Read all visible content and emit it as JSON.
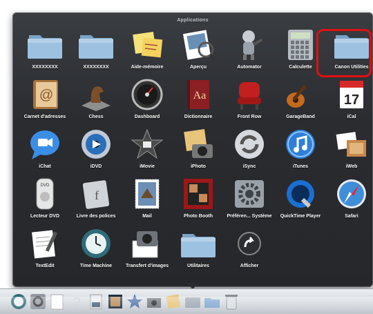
{
  "stack": {
    "title": "Applications",
    "apps": [
      {
        "label": "XXXXXXXX",
        "icon": "folder-icon"
      },
      {
        "label": "XXXXXXXX",
        "icon": "folder-icon"
      },
      {
        "label": "Aide-mémoire",
        "icon": "stickies-icon"
      },
      {
        "label": "Aperçu",
        "icon": "preview-icon"
      },
      {
        "label": "Automator",
        "icon": "automator-robot-icon"
      },
      {
        "label": "Calculette",
        "icon": "calculator-icon"
      },
      {
        "label": "Canon Utilities",
        "icon": "folder-icon"
      },
      {
        "label": "Carnet d'adresses",
        "icon": "address-book-icon"
      },
      {
        "label": "Chess",
        "icon": "chess-knight-icon"
      },
      {
        "label": "Dashboard",
        "icon": "dashboard-gauge-icon"
      },
      {
        "label": "Dictionnaire",
        "icon": "dictionary-icon"
      },
      {
        "label": "Front Row",
        "icon": "front-row-chair-icon"
      },
      {
        "label": "GarageBand",
        "icon": "guitar-icon"
      },
      {
        "label": "iCal",
        "icon": "calendar-icon"
      },
      {
        "label": "iChat",
        "icon": "chat-bubble-icon"
      },
      {
        "label": "iDVD",
        "icon": "dvd-disc-icon"
      },
      {
        "label": "iMovie",
        "icon": "movie-star-icon"
      },
      {
        "label": "iPhoto",
        "icon": "photo-camera-icon"
      },
      {
        "label": "iSync",
        "icon": "sync-icon"
      },
      {
        "label": "iTunes",
        "icon": "music-note-icon"
      },
      {
        "label": "iWeb",
        "icon": "web-photos-icon"
      },
      {
        "label": "Lecteur DVD",
        "icon": "dvd-remote-icon"
      },
      {
        "label": "Livre des polices",
        "icon": "font-book-icon"
      },
      {
        "label": "Mail",
        "icon": "mail-stamp-icon"
      },
      {
        "label": "Photo Booth",
        "icon": "photo-booth-icon"
      },
      {
        "label": "Préféren... Système",
        "icon": "system-preferences-icon"
      },
      {
        "label": "QuickTime Player",
        "icon": "quicktime-icon"
      },
      {
        "label": "Safari",
        "icon": "compass-icon"
      },
      {
        "label": "TextEdit",
        "icon": "textedit-pen-icon"
      },
      {
        "label": "Time Machine",
        "icon": "time-machine-clock-icon"
      },
      {
        "label": "Transfert d'images",
        "icon": "image-capture-camera-icon"
      },
      {
        "label": "Utilitaires",
        "icon": "utilities-folder-icon"
      },
      {
        "label": "Afficher",
        "icon": "open-arrow-icon"
      }
    ]
  },
  "highlight": {
    "target": "Canon Utilities",
    "color": "#e01010"
  },
  "dock": {
    "items": [
      "time-machine-icon",
      "system-preferences-icon",
      "textedit-icon",
      "help-question-icon",
      "document-icon",
      "photo-icon",
      "imovie-icon",
      "image-capture-icon",
      "photos-icon",
      "applications-stack-icon",
      "folder-icon",
      "trash-icon"
    ]
  },
  "colors": {
    "stack_background": "#2a2c30",
    "label_text": "#ffffff",
    "folder_blue": "#8fb5d6"
  }
}
